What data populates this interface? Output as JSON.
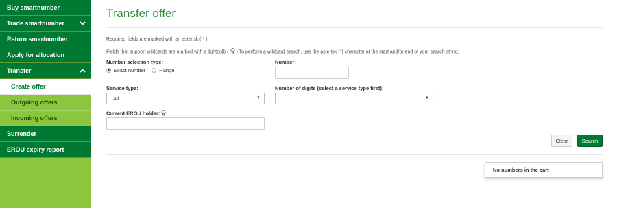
{
  "sidebar": {
    "items": [
      {
        "label": "Buy smartnumber",
        "name": "sidebar-item-buy-smartnumber",
        "type": "primary"
      },
      {
        "label": "Trade smartnumber",
        "name": "sidebar-item-trade-smartnumber",
        "type": "primary",
        "chevron": "chevron-down-icon"
      },
      {
        "label": "Return smartnumber",
        "name": "sidebar-item-return-smartnumber",
        "type": "primary"
      },
      {
        "label": "Apply for allocation",
        "name": "sidebar-item-apply-for-allocation",
        "type": "primary"
      },
      {
        "label": "Transfer",
        "name": "sidebar-item-transfer",
        "type": "primary",
        "chevron": "chevron-up-icon"
      },
      {
        "label": "Create offer",
        "name": "sidebar-item-create-offer",
        "type": "sub",
        "active": true
      },
      {
        "label": "Outgoing offers",
        "name": "sidebar-item-outgoing-offers",
        "type": "sub"
      },
      {
        "label": "Incoming offers",
        "name": "sidebar-item-incoming-offers",
        "type": "sub"
      },
      {
        "label": "Surrender",
        "name": "sidebar-item-surrender",
        "type": "primary"
      },
      {
        "label": "EROU expiry report",
        "name": "sidebar-item-erou-expiry-report",
        "type": "primary"
      }
    ]
  },
  "colors": {
    "primary_green": "#007a33",
    "secondary_green": "#8cc63f",
    "title_green": "#2e8b3d",
    "asterisk_red": "#cc0000"
  },
  "main": {
    "title": "Transfer offer",
    "required_note_pre": "Required fields are marked with an asterisk (",
    "required_note_star": " * ",
    "required_note_post": ").",
    "wildcard_note_pre": "Fields that support wildcards are marked with a lightbulb (",
    "wildcard_note_post": ") To perform a wildcard search, use the asterisk (*) character at the start and/or end of your search string.",
    "number_selection_label": "Number selection type:",
    "radio_exact": "Exact number",
    "radio_range": "Range",
    "radio_selected": "Exact number",
    "number_label": "Number:",
    "number_value": "",
    "service_type_label": "Service type:",
    "service_type_value": "All",
    "digits_label": "Number of digits (select a service type first):",
    "digits_value": "",
    "erou_holder_label": "Current EROU holder:",
    "erou_holder_value": "",
    "clear_label": "Clear",
    "search_label": "Search",
    "cart_text": "No numbers in the cart"
  }
}
